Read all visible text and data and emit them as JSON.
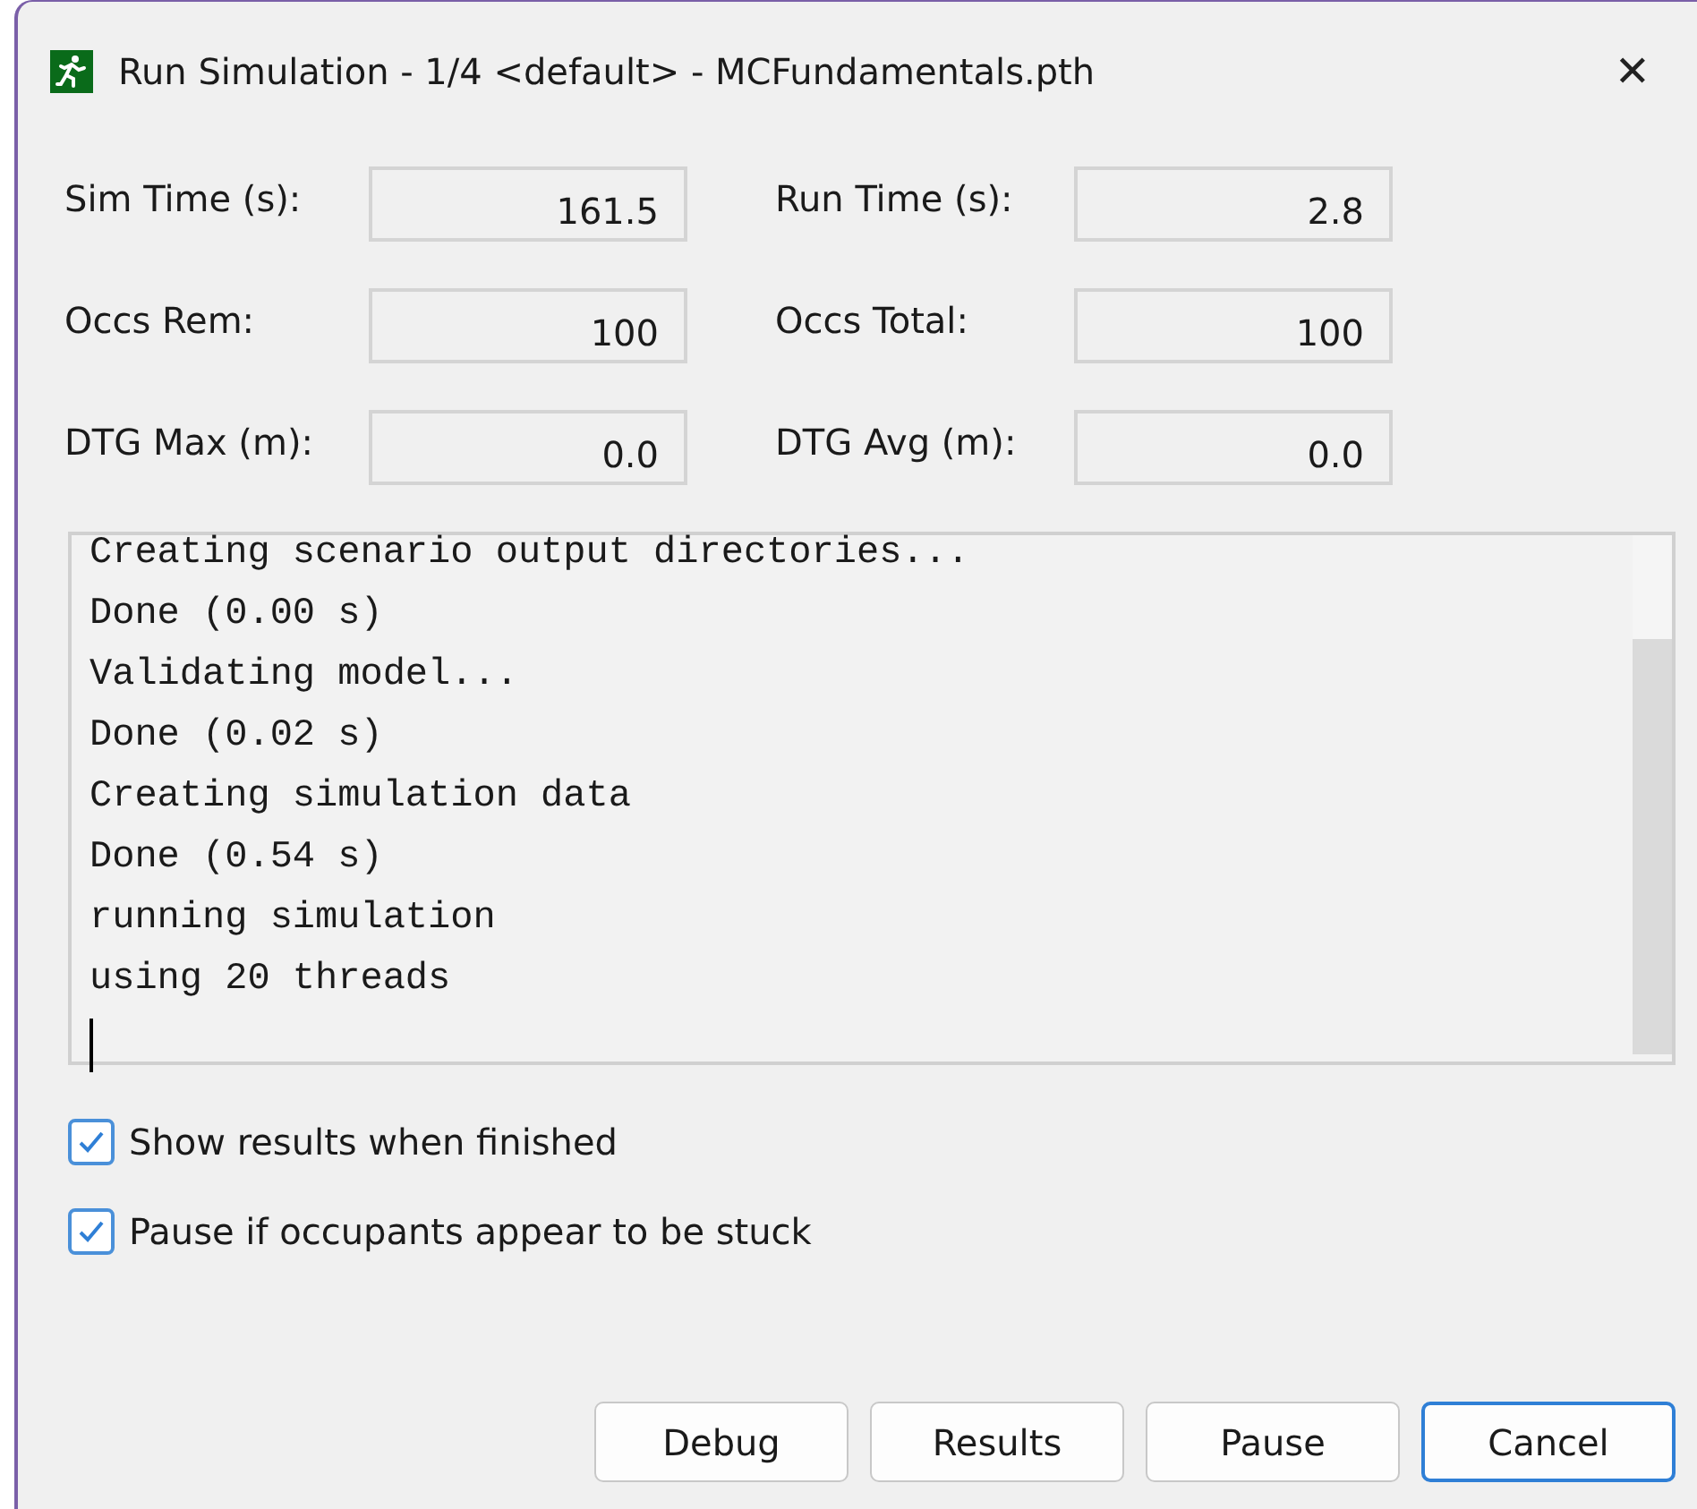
{
  "window": {
    "title": "Run Simulation - 1/4 <default> - MCFundamentals.pth",
    "close": "✕"
  },
  "fields": [
    {
      "label": "Sim Time (s):",
      "value": "161.5"
    },
    {
      "label": "Run Time (s):",
      "value": "2.8"
    },
    {
      "label": "Occs Rem:",
      "value": "100"
    },
    {
      "label": "Occs Total:",
      "value": "100"
    },
    {
      "label": "DTG Max (m):",
      "value": "0.0"
    },
    {
      "label": "DTG Avg (m):",
      "value": "0.0"
    }
  ],
  "log": [
    "Creating scenario output directories...",
    "Done (0.00 s)",
    "Validating model...",
    "Done (0.02 s)",
    "Creating simulation data",
    "Done (0.54 s)",
    "running simulation",
    "using 20 threads"
  ],
  "options": [
    {
      "label": "Show results when finished",
      "checked": true
    },
    {
      "label": "Pause if occupants appear to be stuck",
      "checked": true
    }
  ],
  "buttons": [
    {
      "label": "Debug",
      "default": false
    },
    {
      "label": "Results",
      "default": false
    },
    {
      "label": "Pause",
      "default": false
    },
    {
      "label": "Cancel",
      "default": true
    }
  ]
}
